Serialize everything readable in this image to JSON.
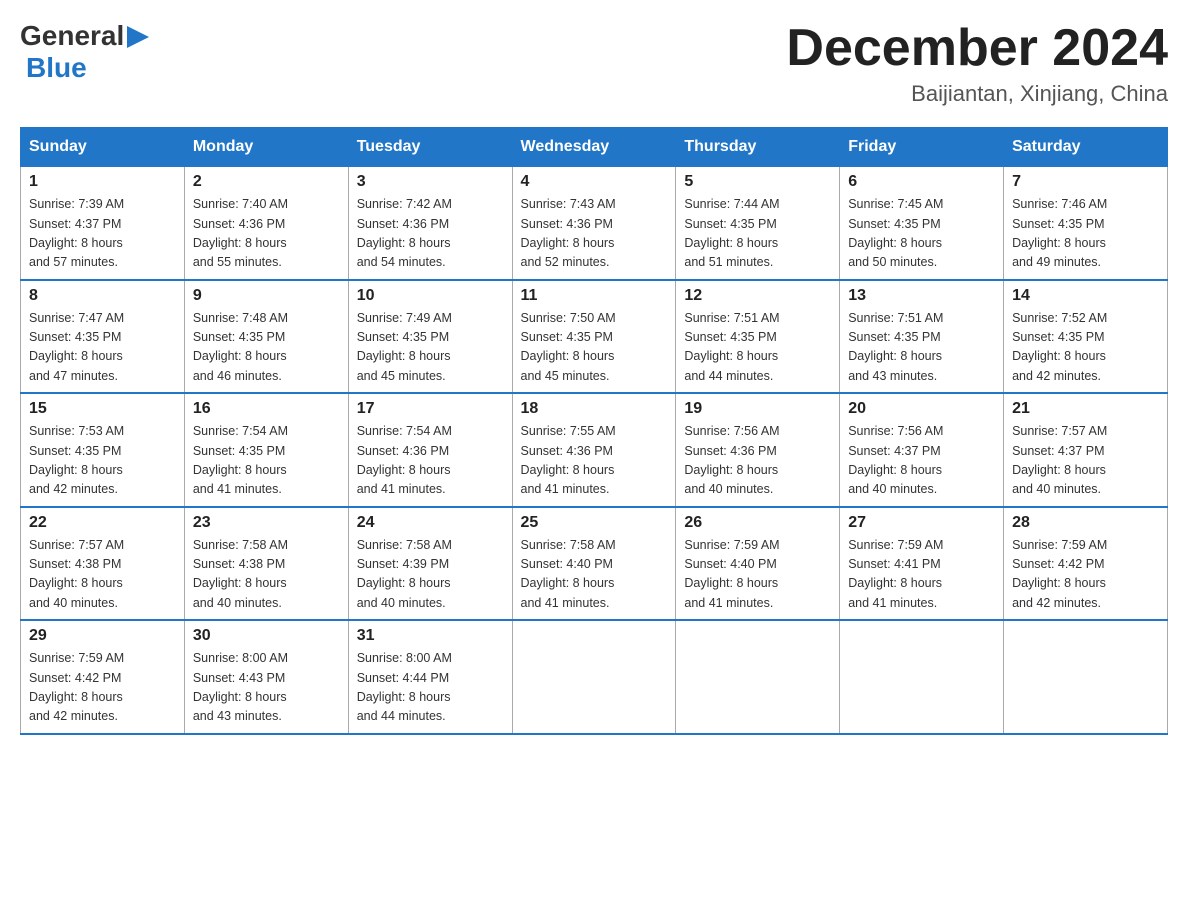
{
  "header": {
    "logo_general": "General",
    "logo_blue": "Blue",
    "month_title": "December 2024",
    "location": "Baijiantan, Xinjiang, China"
  },
  "days_of_week": [
    "Sunday",
    "Monday",
    "Tuesday",
    "Wednesday",
    "Thursday",
    "Friday",
    "Saturday"
  ],
  "weeks": [
    [
      {
        "day": "1",
        "sunrise": "7:39 AM",
        "sunset": "4:37 PM",
        "daylight": "8 hours and 57 minutes."
      },
      {
        "day": "2",
        "sunrise": "7:40 AM",
        "sunset": "4:36 PM",
        "daylight": "8 hours and 55 minutes."
      },
      {
        "day": "3",
        "sunrise": "7:42 AM",
        "sunset": "4:36 PM",
        "daylight": "8 hours and 54 minutes."
      },
      {
        "day": "4",
        "sunrise": "7:43 AM",
        "sunset": "4:36 PM",
        "daylight": "8 hours and 52 minutes."
      },
      {
        "day": "5",
        "sunrise": "7:44 AM",
        "sunset": "4:35 PM",
        "daylight": "8 hours and 51 minutes."
      },
      {
        "day": "6",
        "sunrise": "7:45 AM",
        "sunset": "4:35 PM",
        "daylight": "8 hours and 50 minutes."
      },
      {
        "day": "7",
        "sunrise": "7:46 AM",
        "sunset": "4:35 PM",
        "daylight": "8 hours and 49 minutes."
      }
    ],
    [
      {
        "day": "8",
        "sunrise": "7:47 AM",
        "sunset": "4:35 PM",
        "daylight": "8 hours and 47 minutes."
      },
      {
        "day": "9",
        "sunrise": "7:48 AM",
        "sunset": "4:35 PM",
        "daylight": "8 hours and 46 minutes."
      },
      {
        "day": "10",
        "sunrise": "7:49 AM",
        "sunset": "4:35 PM",
        "daylight": "8 hours and 45 minutes."
      },
      {
        "day": "11",
        "sunrise": "7:50 AM",
        "sunset": "4:35 PM",
        "daylight": "8 hours and 45 minutes."
      },
      {
        "day": "12",
        "sunrise": "7:51 AM",
        "sunset": "4:35 PM",
        "daylight": "8 hours and 44 minutes."
      },
      {
        "day": "13",
        "sunrise": "7:51 AM",
        "sunset": "4:35 PM",
        "daylight": "8 hours and 43 minutes."
      },
      {
        "day": "14",
        "sunrise": "7:52 AM",
        "sunset": "4:35 PM",
        "daylight": "8 hours and 42 minutes."
      }
    ],
    [
      {
        "day": "15",
        "sunrise": "7:53 AM",
        "sunset": "4:35 PM",
        "daylight": "8 hours and 42 minutes."
      },
      {
        "day": "16",
        "sunrise": "7:54 AM",
        "sunset": "4:35 PM",
        "daylight": "8 hours and 41 minutes."
      },
      {
        "day": "17",
        "sunrise": "7:54 AM",
        "sunset": "4:36 PM",
        "daylight": "8 hours and 41 minutes."
      },
      {
        "day": "18",
        "sunrise": "7:55 AM",
        "sunset": "4:36 PM",
        "daylight": "8 hours and 41 minutes."
      },
      {
        "day": "19",
        "sunrise": "7:56 AM",
        "sunset": "4:36 PM",
        "daylight": "8 hours and 40 minutes."
      },
      {
        "day": "20",
        "sunrise": "7:56 AM",
        "sunset": "4:37 PM",
        "daylight": "8 hours and 40 minutes."
      },
      {
        "day": "21",
        "sunrise": "7:57 AM",
        "sunset": "4:37 PM",
        "daylight": "8 hours and 40 minutes."
      }
    ],
    [
      {
        "day": "22",
        "sunrise": "7:57 AM",
        "sunset": "4:38 PM",
        "daylight": "8 hours and 40 minutes."
      },
      {
        "day": "23",
        "sunrise": "7:58 AM",
        "sunset": "4:38 PM",
        "daylight": "8 hours and 40 minutes."
      },
      {
        "day": "24",
        "sunrise": "7:58 AM",
        "sunset": "4:39 PM",
        "daylight": "8 hours and 40 minutes."
      },
      {
        "day": "25",
        "sunrise": "7:58 AM",
        "sunset": "4:40 PM",
        "daylight": "8 hours and 41 minutes."
      },
      {
        "day": "26",
        "sunrise": "7:59 AM",
        "sunset": "4:40 PM",
        "daylight": "8 hours and 41 minutes."
      },
      {
        "day": "27",
        "sunrise": "7:59 AM",
        "sunset": "4:41 PM",
        "daylight": "8 hours and 41 minutes."
      },
      {
        "day": "28",
        "sunrise": "7:59 AM",
        "sunset": "4:42 PM",
        "daylight": "8 hours and 42 minutes."
      }
    ],
    [
      {
        "day": "29",
        "sunrise": "7:59 AM",
        "sunset": "4:42 PM",
        "daylight": "8 hours and 42 minutes."
      },
      {
        "day": "30",
        "sunrise": "8:00 AM",
        "sunset": "4:43 PM",
        "daylight": "8 hours and 43 minutes."
      },
      {
        "day": "31",
        "sunrise": "8:00 AM",
        "sunset": "4:44 PM",
        "daylight": "8 hours and 44 minutes."
      },
      null,
      null,
      null,
      null
    ]
  ],
  "labels": {
    "sunrise": "Sunrise:",
    "sunset": "Sunset:",
    "daylight": "Daylight:"
  }
}
